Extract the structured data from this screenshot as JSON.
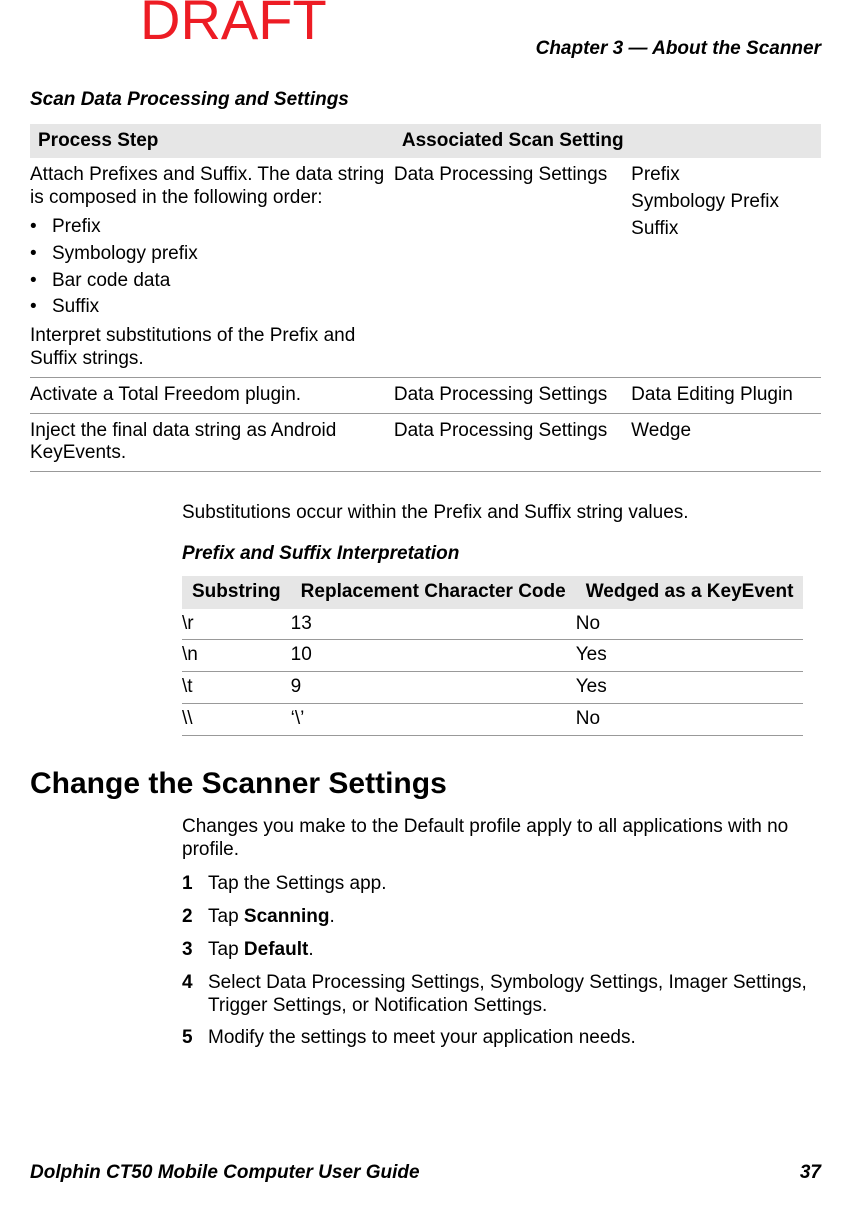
{
  "watermark": "DRAFT",
  "chapter_header": "Chapter 3 — About the Scanner",
  "table1": {
    "caption": "Scan Data Processing and Settings",
    "headers": [
      "Process Step",
      "Associated Scan Setting"
    ],
    "rows": [
      {
        "step_intro": "Attach Prefixes and Suffix. The data string is composed in the following order:",
        "bullets": [
          "Prefix",
          "Symbology prefix",
          "Bar code data",
          "Suffix"
        ],
        "step_outro": "Interpret substitutions of the Prefix and Suffix strings.",
        "setting_a": "Data Processing Settings",
        "setting_b": [
          "Prefix",
          "Symbology Prefix",
          "Suffix"
        ]
      },
      {
        "step": "Activate a Total Freedom plugin.",
        "setting_a": "Data Processing Settings",
        "setting_b_single": "Data Editing Plugin"
      },
      {
        "step": "Inject the final data string as Android KeyEvents.",
        "setting_a": "Data Processing Settings",
        "setting_b_single": "Wedge"
      }
    ]
  },
  "para1": "Substitutions occur within the Prefix and Suffix string values.",
  "table2": {
    "caption": "Prefix and Suffix Interpretation",
    "headers": [
      "Substring",
      "Replacement Character Code",
      "Wedged as a KeyEvent"
    ],
    "rows": [
      {
        "c0": "\\r",
        "c1": "13",
        "c2": "No"
      },
      {
        "c0": "\\n",
        "c1": "10",
        "c2": "Yes"
      },
      {
        "c0": "\\t",
        "c1": "9",
        "c2": "Yes"
      },
      {
        "c0": "\\\\",
        "c1": "‘\\’",
        "c2": "No"
      }
    ]
  },
  "heading2": "Change the Scanner Settings",
  "section_intro": "Changes you make to the Default profile apply to all applications with no profile.",
  "steps": [
    {
      "pre": "Tap the Settings app."
    },
    {
      "pre": "Tap ",
      "bold": "Scanning",
      "post": "."
    },
    {
      "pre": "Tap ",
      "bold": "Default",
      "post": "."
    },
    {
      "pre": "Select Data Processing Settings, Symbology Settings, Imager Settings, Trigger Settings, or Notification Settings."
    },
    {
      "pre": "Modify the settings to meet your application needs."
    }
  ],
  "footer_left": "Dolphin CT50 Mobile Computer User Guide",
  "footer_right": "37"
}
